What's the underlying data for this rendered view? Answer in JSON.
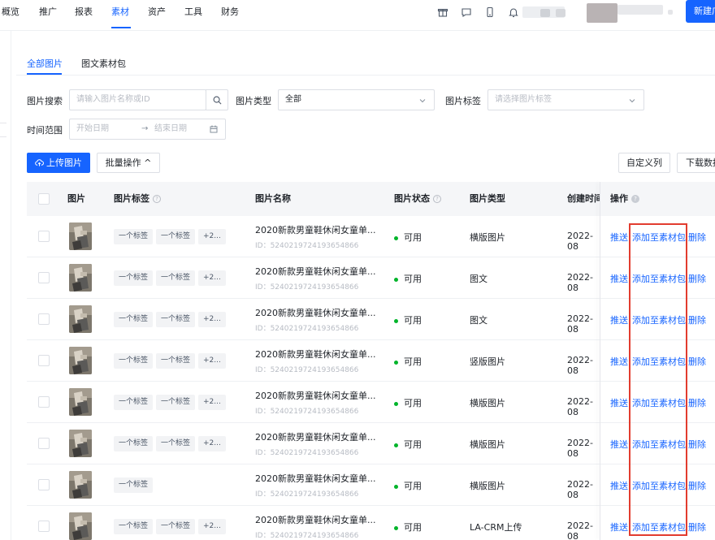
{
  "nav": {
    "items": [
      "概览",
      "推广",
      "报表",
      "素材",
      "资产",
      "工具",
      "财务"
    ],
    "active": "素材",
    "new_label": "新建广"
  },
  "tabs": [
    "全部图片",
    "图文素材包"
  ],
  "filters": {
    "search_label": "图片搜索",
    "search_placeholder": "请输入图片名称或ID",
    "type_label": "图片类型",
    "type_value": "全部",
    "tag_label": "图片标签",
    "tag_placeholder": "请选择图片标签",
    "time_label": "时间范围",
    "start_placeholder": "开始日期",
    "end_placeholder": "结束日期"
  },
  "actions": {
    "upload": "上传图片",
    "batch": "批量操作 ^",
    "custom_cols": "自定义列",
    "download": "下载数据"
  },
  "table": {
    "headers": {
      "image": "图片",
      "tags": "图片标签",
      "name": "图片名称",
      "status": "图片状态",
      "type": "图片类型",
      "created": "创建时间",
      "ops": "操作"
    },
    "ops": {
      "push": "推送",
      "add": "添加至素材包",
      "delete": "删除"
    },
    "rows": [
      {
        "tags": [
          "一个标签",
          "一个标签",
          "+2..."
        ],
        "name": "2020新款男童鞋休闲女童单...",
        "id": "ID：5240219724193654866",
        "status": "可用",
        "type": "横版图片",
        "created": "2022-08"
      },
      {
        "tags": [
          "一个标签",
          "一个标签",
          "+2..."
        ],
        "name": "2020新款男童鞋休闲女童单...",
        "id": "ID：5240219724193654866",
        "status": "可用",
        "type": "图文",
        "created": "2022-08"
      },
      {
        "tags": [
          "一个标签",
          "一个标签",
          "+2..."
        ],
        "name": "2020新款男童鞋休闲女童单...",
        "id": "ID：5240219724193654866",
        "status": "可用",
        "type": "图文",
        "created": "2022-08"
      },
      {
        "tags": [
          "一个标签",
          "一个标签",
          "+2..."
        ],
        "name": "2020新款男童鞋休闲女童单...",
        "id": "ID：5240219724193654866",
        "status": "可用",
        "type": "竖版图片",
        "created": "2022-08"
      },
      {
        "tags": [
          "一个标签",
          "一个标签",
          "+2..."
        ],
        "name": "2020新款男童鞋休闲女童单...",
        "id": "ID：5240219724193654866",
        "status": "可用",
        "type": "横版图片",
        "created": "2022-08"
      },
      {
        "tags": [
          "一个标签",
          "一个标签",
          "+2..."
        ],
        "name": "2020新款男童鞋休闲女童单...",
        "id": "ID：5240219724193654866",
        "status": "可用",
        "type": "横版图片",
        "created": "2022-08"
      },
      {
        "tags": [
          "一个标签"
        ],
        "name": "2020新款男童鞋休闲女童单...",
        "id": "ID：5240219724193654866",
        "status": "可用",
        "type": "横版图片",
        "created": "2022-08"
      },
      {
        "tags": [
          "一个标签",
          "一个标签",
          "+2..."
        ],
        "name": "2020新款男童鞋休闲女童单...",
        "id": "ID：5240219724193654866",
        "status": "可用",
        "type": "LA-CRM上传",
        "created": "2022-08"
      }
    ]
  },
  "colors": {
    "primary": "#1664ff",
    "highlight": "#e23c2f",
    "status_ok": "#00b42a"
  },
  "icons": [
    "gift-icon",
    "message-icon",
    "phone-icon",
    "bell-icon",
    "search-icon",
    "chevron-down-icon",
    "calendar-icon",
    "upload-cloud-icon",
    "question-icon"
  ]
}
